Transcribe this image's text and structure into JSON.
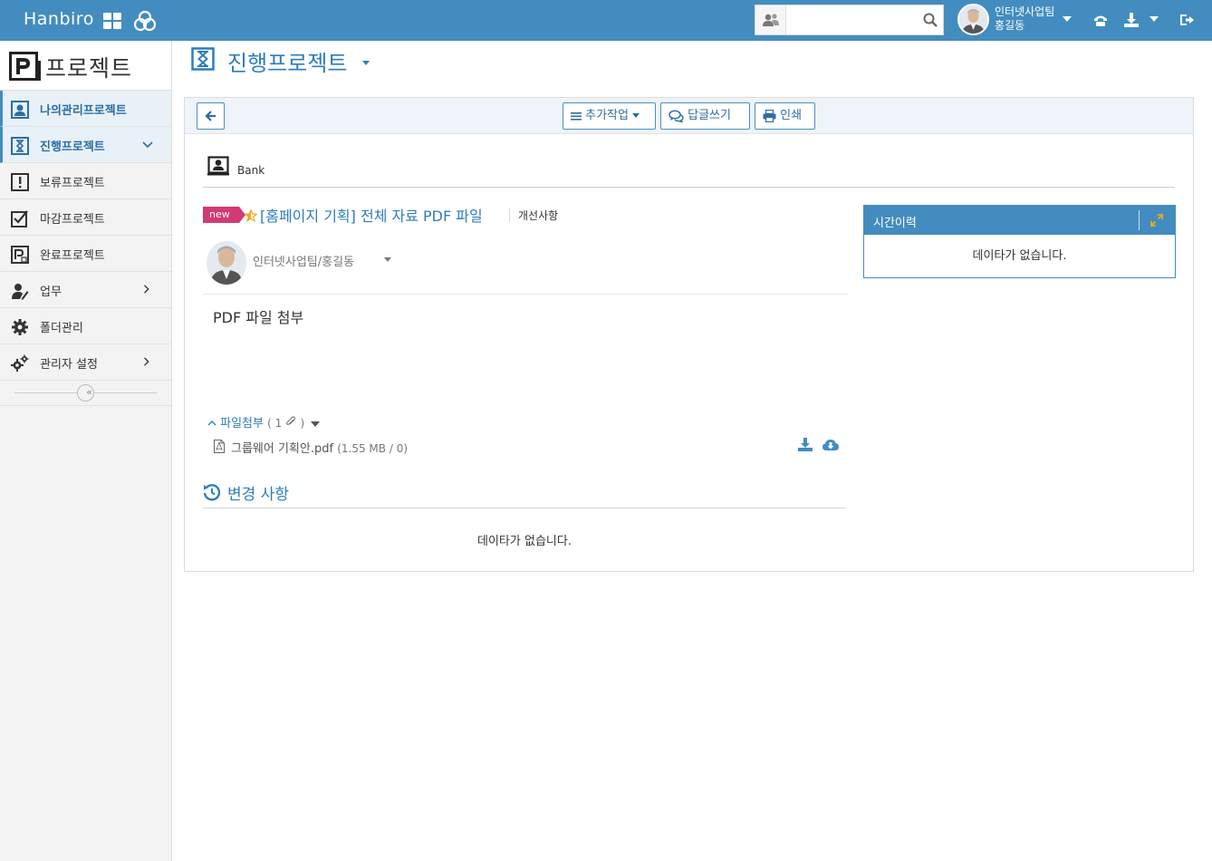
{
  "topbar": {
    "brand": "Hanbiro",
    "search_placeholder": "",
    "user_team": "인터넷사업팀",
    "user_name": "홍길동"
  },
  "sidebar": {
    "title": "프로젝트",
    "items": [
      {
        "label": "나의관리프로젝트",
        "icon": "my-project-icon"
      },
      {
        "label": "진행프로젝트",
        "icon": "hourglass-icon"
      },
      {
        "label": "보류프로젝트",
        "icon": "pending-icon"
      },
      {
        "label": "마감프로젝트",
        "icon": "check-icon"
      },
      {
        "label": "완료프로젝트",
        "icon": "complete-icon"
      },
      {
        "label": "업무",
        "icon": "task-icon"
      },
      {
        "label": "폴더관리",
        "icon": "gear-icon"
      },
      {
        "label": "관리자 설정",
        "icon": "gears-icon"
      }
    ],
    "collapse_label": "«"
  },
  "page": {
    "title": "진행프로젝트"
  },
  "toolbar": {
    "more_label": "추가작업",
    "reply_label": "답글쓰기",
    "print_label": "인쇄"
  },
  "post": {
    "bank_label": "Bank",
    "badge": "new",
    "title": "[홈페이지 기획] 전체 자료 PDF 파일",
    "category": "개선사항",
    "author": "인터넷사업팀/홍길동",
    "body": "PDF 파일 첨부",
    "attach_label": "파일첨부",
    "attach_count": "( 1",
    "attach_close": ")",
    "file_name": "그룹웨어 기획안.pdf",
    "file_meta": "(1.55 MB / 0)"
  },
  "changes": {
    "title": "변경 사항",
    "empty": "데이타가 없습니다."
  },
  "history": {
    "title": "시간이력",
    "empty": "데이타가 없습니다."
  },
  "colors": {
    "brand": "#438cbf",
    "link": "#2e7dbb",
    "badge": "#d23a73",
    "star": "#f0a81c"
  }
}
